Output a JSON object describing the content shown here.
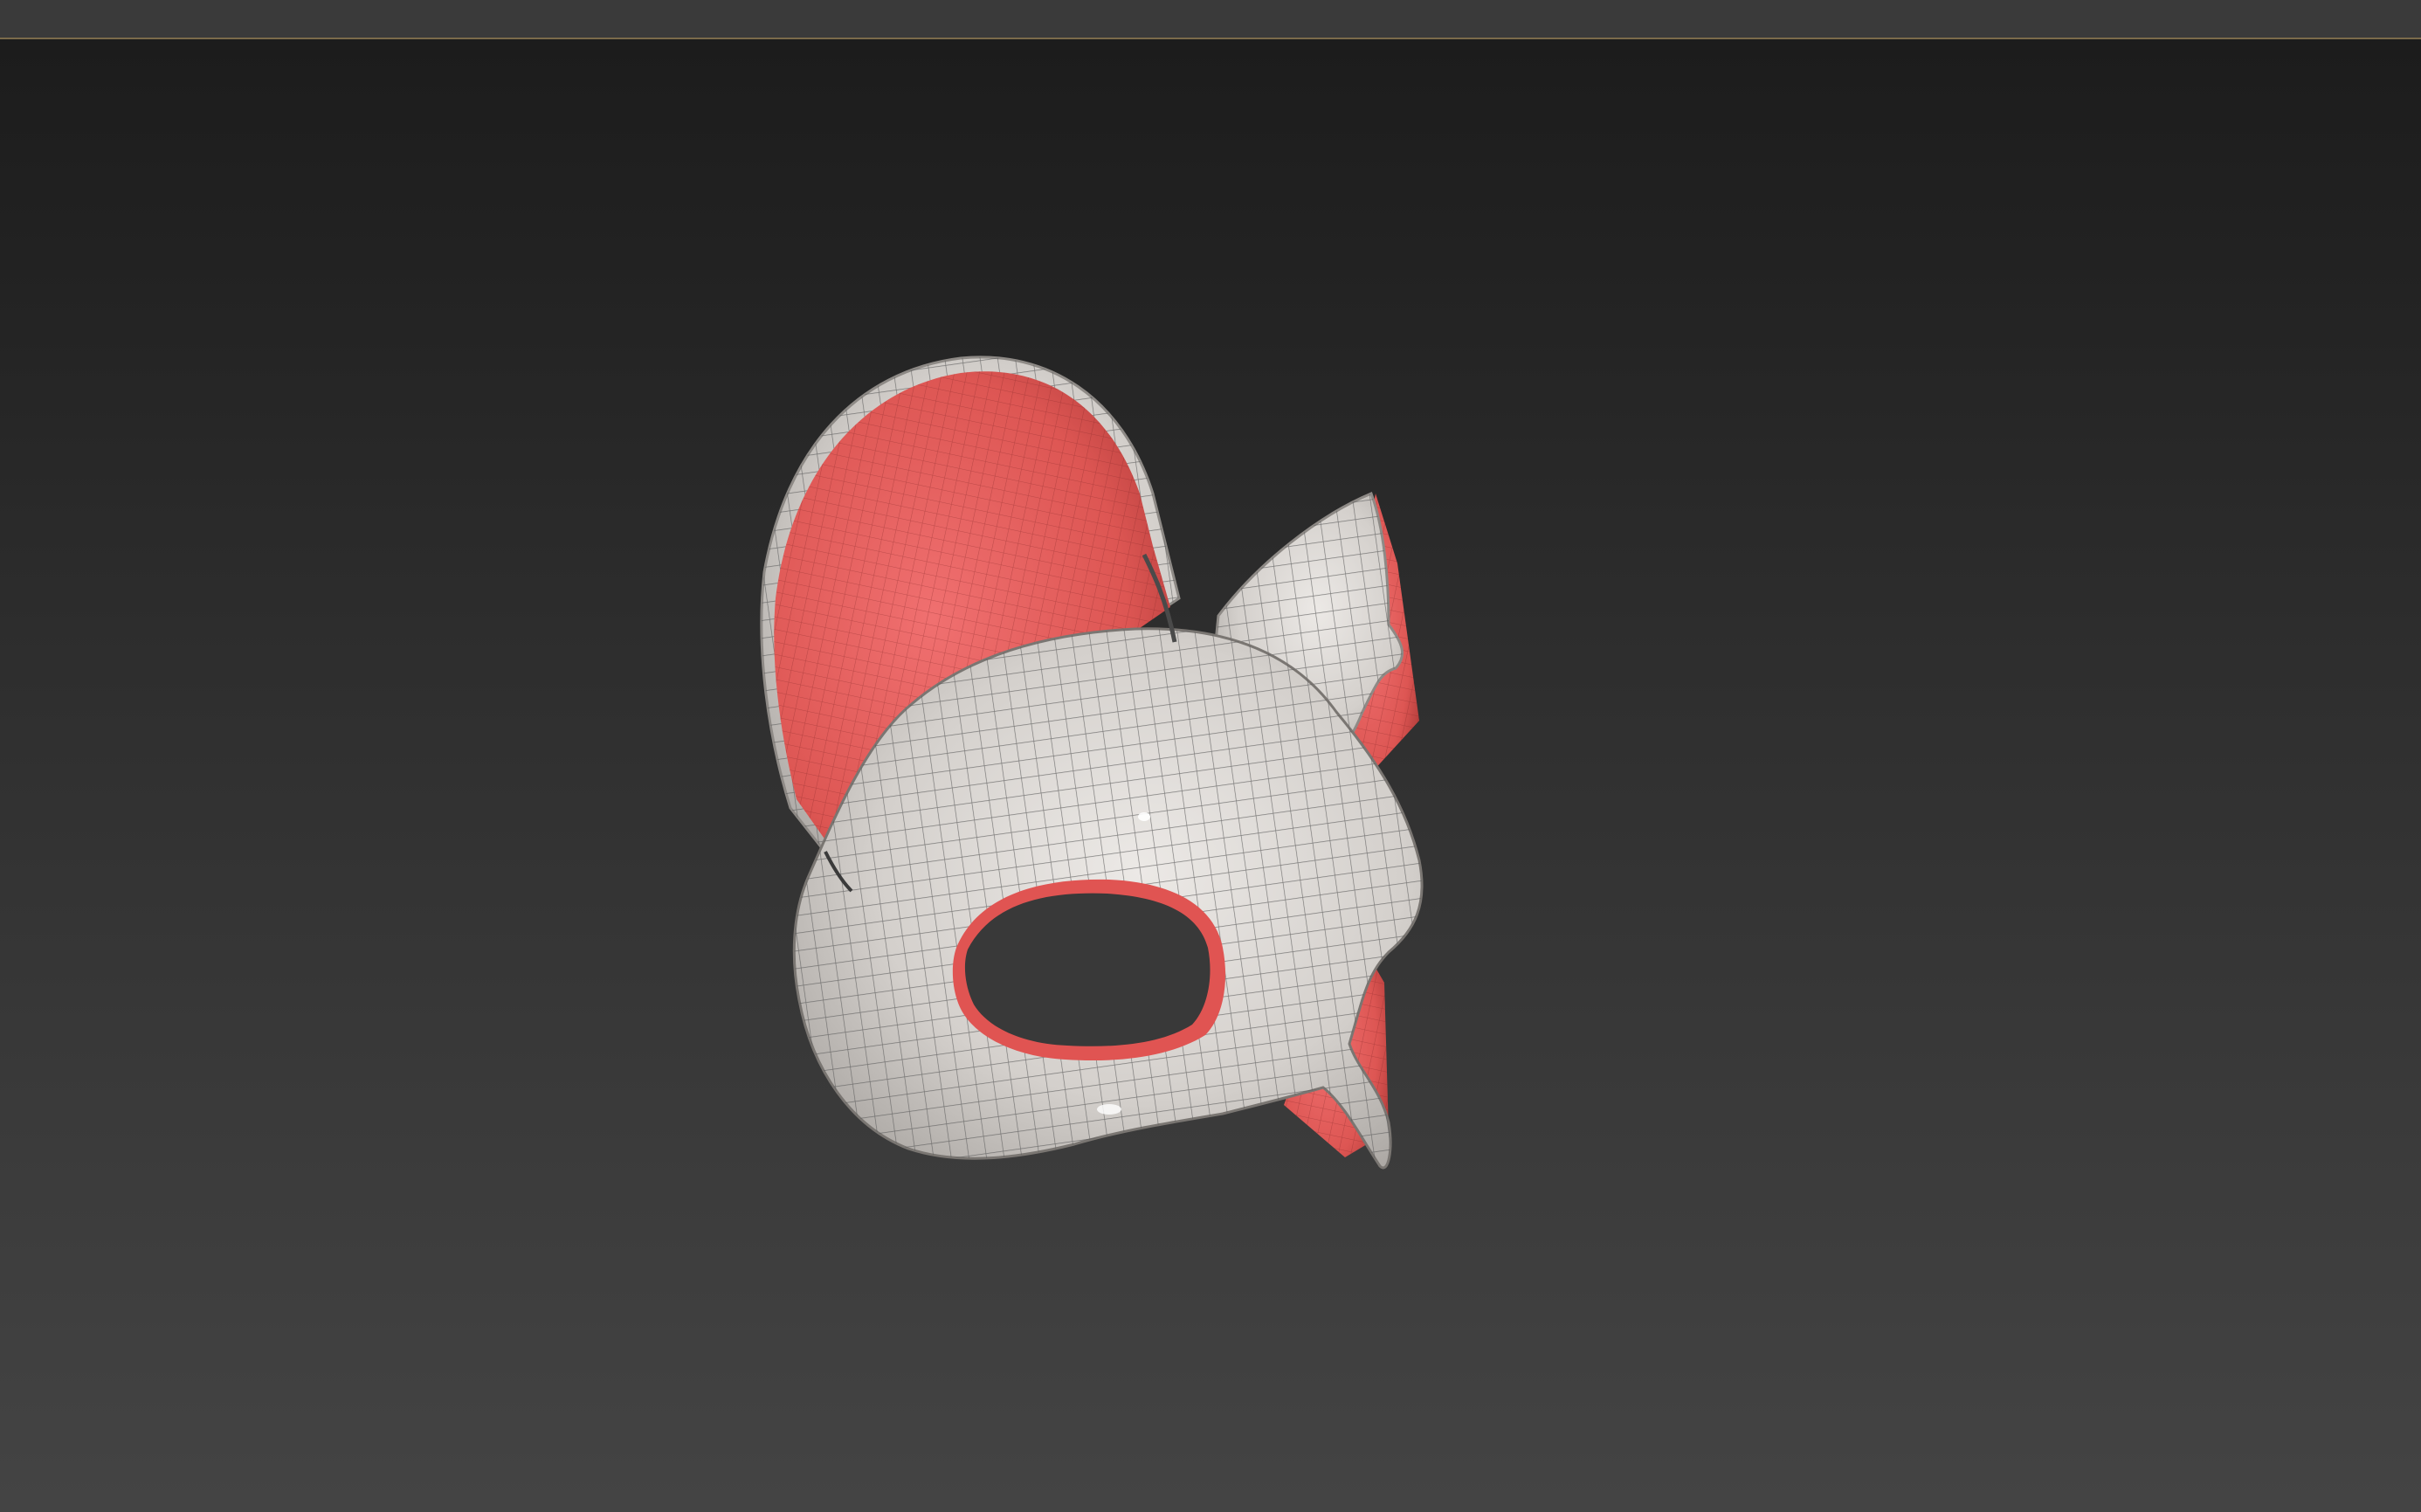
{
  "app": {
    "title": ""
  },
  "viewport": {
    "object": "cat-mask",
    "shading": "smooth-with-wireframe",
    "colors": {
      "background_top": "#1c1c1c",
      "background_bottom": "#444444",
      "surface": "#d6d2ce",
      "inner_surface": "#e25a58",
      "wire": "#5b5b5b"
    }
  }
}
